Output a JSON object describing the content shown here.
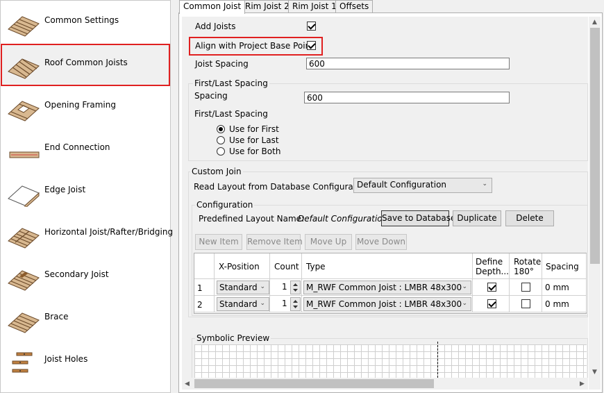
{
  "sidebar": {
    "items": [
      {
        "label": "Common Settings",
        "icon": "joist-grid-icon"
      },
      {
        "label": "Roof Common Joists",
        "icon": "roof-joist-icon"
      },
      {
        "label": "Opening Framing",
        "icon": "opening-framing-icon"
      },
      {
        "label": "End Connection",
        "icon": "end-connection-icon"
      },
      {
        "label": "Edge Joist",
        "icon": "edge-joist-icon"
      },
      {
        "label": "Horizontal Joist/Rafter/Bridging",
        "icon": "bridging-icon"
      },
      {
        "label": "Secondary Joist",
        "icon": "secondary-joist-icon"
      },
      {
        "label": "Brace",
        "icon": "brace-icon"
      },
      {
        "label": "Joist Holes",
        "icon": "joist-holes-icon"
      }
    ],
    "selected_index": 1
  },
  "tabs": [
    {
      "label": "Common Joist",
      "active": true
    },
    {
      "label": "Rim Joist 2",
      "active": false
    },
    {
      "label": "Rim Joist 1",
      "active": false
    },
    {
      "label": "Offsets",
      "active": false
    }
  ],
  "form": {
    "add_joists_label": "Add Joists",
    "add_joists_checked": true,
    "align_label": "Align with Project Base Point",
    "align_checked": true,
    "joist_spacing_label": "Joist Spacing",
    "joist_spacing_value": "600",
    "first_last_group": "First/Last Spacing",
    "spacing_label": "Spacing",
    "spacing_value": "600",
    "first_last_label": "First/Last Spacing",
    "radio_options": [
      "Use for First",
      "Use for Last",
      "Use for Both"
    ],
    "radio_selected": 0
  },
  "custom_join": {
    "group_label": "Custom Join",
    "read_layout_label": "Read Layout from Database Configuration:",
    "read_layout_value": "Default Configuration",
    "configuration_group": "Configuration",
    "predefined_label": "Predefined Layout Name:",
    "predefined_value": "Default Configuration",
    "save_button": "Save to Database",
    "duplicate_button": "Duplicate",
    "delete_button": "Delete",
    "new_item_button": "New Item",
    "remove_item_button": "Remove Item",
    "move_up_button": "Move Up",
    "move_down_button": "Move Down"
  },
  "table": {
    "headers": [
      "X-Position",
      "Count",
      "Type",
      "Define Depth...",
      "Rotate 180°",
      "Spacing"
    ],
    "rows": [
      {
        "index": "1",
        "x_position": "Standard",
        "count": "1",
        "type": "M_RWF Common Joist : LMBR 48x300",
        "define_depth": true,
        "rotate": false,
        "spacing": "0 mm"
      },
      {
        "index": "2",
        "x_position": "Standard",
        "count": "1",
        "type": "M_RWF Common Joist : LMBR 48x300",
        "define_depth": true,
        "rotate": false,
        "spacing": "0 mm"
      }
    ]
  },
  "preview": {
    "label": "Symbolic Preview"
  }
}
